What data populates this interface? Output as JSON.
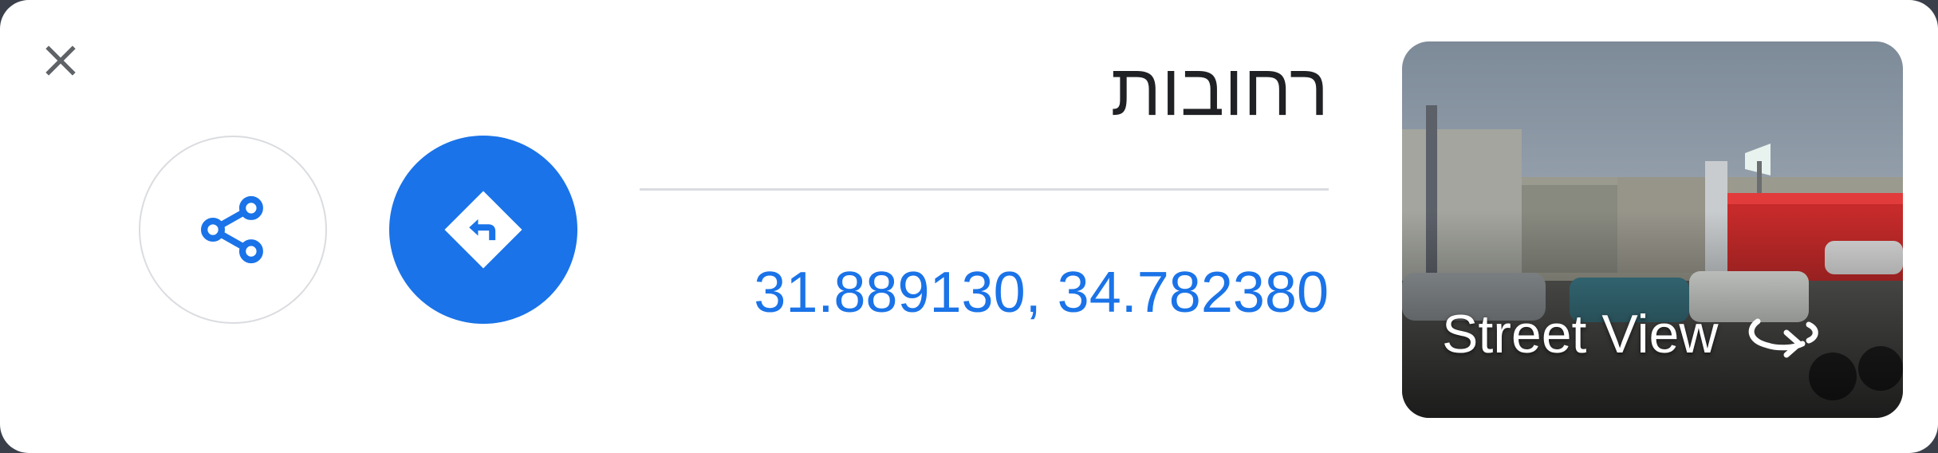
{
  "place": {
    "title": "רחובות",
    "coordinates": "31.889130, 34.782380"
  },
  "actions": {
    "close_icon": "close-icon",
    "share_icon": "share-icon",
    "directions_icon": "directions-icon"
  },
  "street_view": {
    "label": "Street View",
    "icon": "rotate-360-icon"
  },
  "colors": {
    "accent": "#1a73e8",
    "title_text": "#202124",
    "divider": "#dadce0",
    "close_icon": "#5f6368"
  }
}
